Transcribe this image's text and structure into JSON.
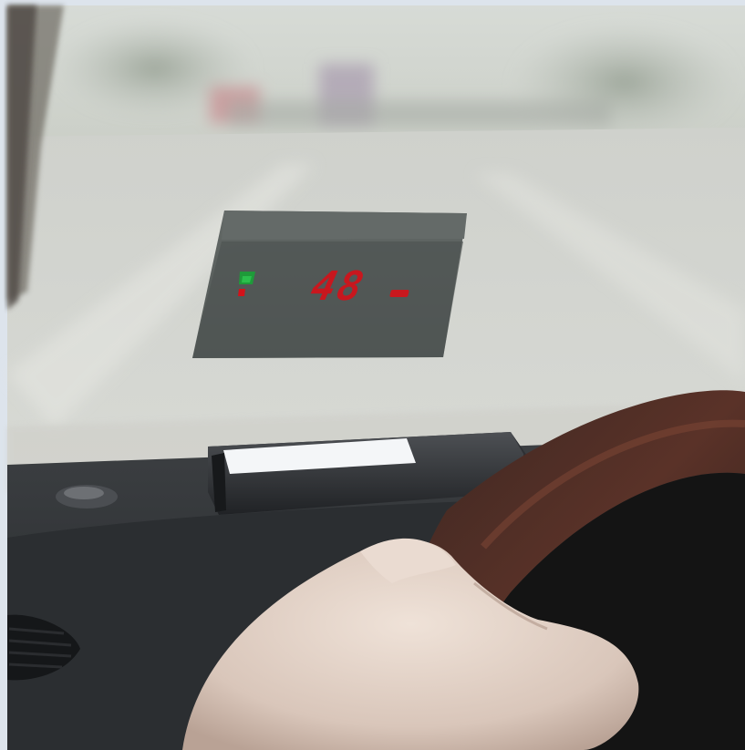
{
  "scene": {
    "hud": {
      "speed_reading": "48",
      "colors": {
        "readout": "#d3121a",
        "signal_green": "#1f9a3a",
        "signal_red": "#d3121a",
        "panel": "#4f5553"
      }
    },
    "icons": {
      "signal": "gps-signal-icon",
      "unit": "speed-unit-icon"
    }
  }
}
